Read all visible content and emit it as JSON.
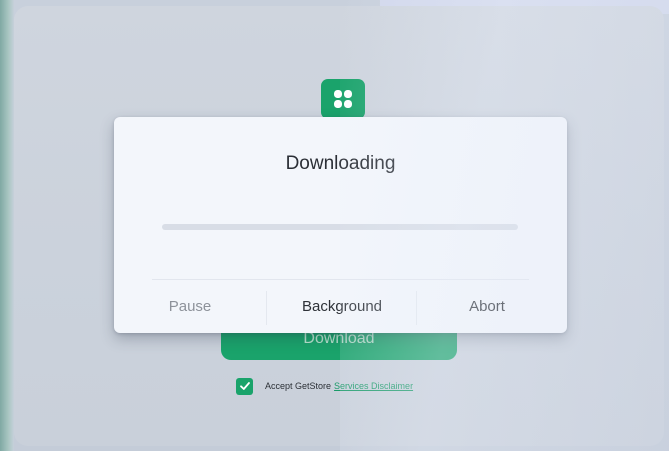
{
  "dialog": {
    "title": "Downloading",
    "progress": 0,
    "actions": {
      "pause_label": "Pause",
      "background_label": "Background",
      "abort_label": "Abort"
    }
  },
  "download_button": {
    "label": "Download"
  },
  "accept": {
    "checked": true,
    "text": "Accept GetStore",
    "link_text": "Services Disclaimer"
  },
  "app": {
    "icon": "clover-app-icon"
  },
  "colors": {
    "accent_green": "#1aa36b",
    "dialog_background": "#f3f6fb",
    "screen_background": "#cbd2dc"
  }
}
